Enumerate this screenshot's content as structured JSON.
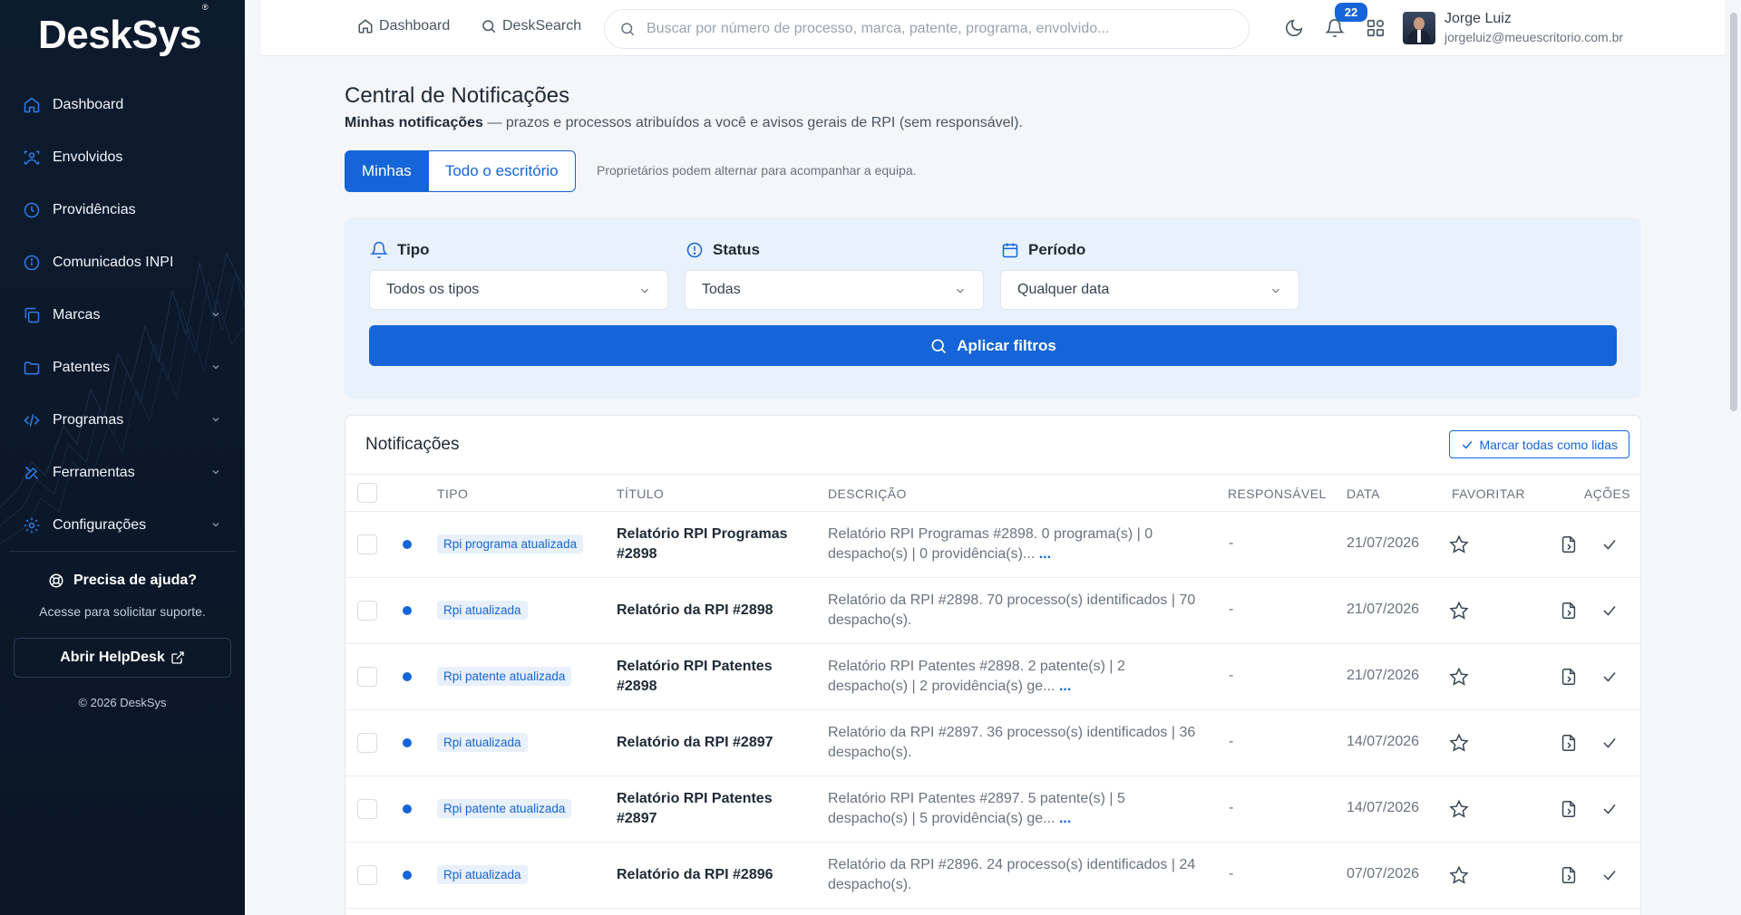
{
  "sidebar": {
    "logo": "DeskSys",
    "items": [
      {
        "label": "Dashboard",
        "icon": "home-icon",
        "expandable": false
      },
      {
        "label": "Envolvidos",
        "icon": "users-icon",
        "expandable": false
      },
      {
        "label": "Providências",
        "icon": "clock-icon",
        "expandable": false
      },
      {
        "label": "Comunicados INPI",
        "icon": "info-icon",
        "expandable": false
      },
      {
        "label": "Marcas",
        "icon": "copy-icon",
        "expandable": true
      },
      {
        "label": "Patentes",
        "icon": "folder-icon",
        "expandable": true
      },
      {
        "label": "Programas",
        "icon": "code-icon",
        "expandable": true
      },
      {
        "label": "Ferramentas",
        "icon": "tools-icon",
        "expandable": true
      },
      {
        "label": "Configurações",
        "icon": "gear-icon",
        "expandable": true
      }
    ],
    "help_title": "Precisa de ajuda?",
    "help_sub": "Acesse para solicitar suporte.",
    "helpdesk_label": "Abrir HelpDesk",
    "copyright": "© 2026 DeskSys"
  },
  "topbar": {
    "dashboard_link": "Dashboard",
    "desksearch_link": "DeskSearch",
    "search_placeholder": "Buscar por número de processo, marca, patente, programa, envolvido...",
    "notification_count": "22",
    "user_name": "Jorge Luiz",
    "user_email": "jorgeluiz@meuescritorio.com.br"
  },
  "page": {
    "title": "Central de Notificações",
    "subtitle_bold": "Minhas notificações",
    "subtitle_rest": " — prazos e processos atribuídos a você e avisos gerais de RPI (sem responsável).",
    "tab_mine": "Minhas",
    "tab_office": "Todo o escritório",
    "tab_hint": "Proprietários podem alternar para acompanhar a equipa."
  },
  "filters": {
    "tipo_label": "Tipo",
    "tipo_value": "Todos os tipos",
    "status_label": "Status",
    "status_value": "Todas",
    "periodo_label": "Período",
    "periodo_value": "Qualquer data",
    "apply_label": "Aplicar filtros"
  },
  "table": {
    "title": "Notificações",
    "mark_all_label": "Marcar todas como lidas",
    "headers": {
      "tipo": "TIPO",
      "titulo": "TÍTULO",
      "descricao": "DESCRIÇÃO",
      "responsavel": "RESPONSÁVEL",
      "data": "DATA",
      "favoritar": "FAVORITAR",
      "acoes": "AÇÕES"
    },
    "rows": [
      {
        "tipo": "Rpi programa atualizada",
        "title": "Relatório RPI Programas #2898",
        "desc": "Relatório RPI Programas #2898. 0 programa(s) | 0 despacho(s) | 0 providência(s)...",
        "more": "...",
        "resp": "-",
        "date": "21/07/2026"
      },
      {
        "tipo": "Rpi atualizada",
        "title": "Relatório da RPI #2898",
        "desc": "Relatório da RPI #2898. 70 processo(s) identificados | 70 despacho(s).",
        "more": "",
        "resp": "-",
        "date": "21/07/2026"
      },
      {
        "tipo": "Rpi patente atualizada",
        "title": "Relatório RPI Patentes #2898",
        "desc": "Relatório RPI Patentes #2898. 2 patente(s) | 2 despacho(s) | 2 providência(s) ge...",
        "more": "...",
        "resp": "-",
        "date": "21/07/2026"
      },
      {
        "tipo": "Rpi atualizada",
        "title": "Relatório da RPI #2897",
        "desc": "Relatório da RPI #2897. 36 processo(s) identificados | 36 despacho(s).",
        "more": "",
        "resp": "-",
        "date": "14/07/2026"
      },
      {
        "tipo": "Rpi patente atualizada",
        "title": "Relatório RPI Patentes #2897",
        "desc": "Relatório RPI Patentes #2897. 5 patente(s) | 5 despacho(s) | 5 providência(s) ge...",
        "more": "...",
        "resp": "-",
        "date": "14/07/2026"
      },
      {
        "tipo": "Rpi atualizada",
        "title": "Relatório da RPI #2896",
        "desc": "Relatório da RPI #2896. 24 processo(s) identificados | 24 despacho(s).",
        "more": "",
        "resp": "-",
        "date": "07/07/2026"
      }
    ]
  },
  "colors": {
    "primary": "#1565d8",
    "sidebar_bg": "#0d1b2e",
    "filter_bg": "#e9f1fb"
  }
}
